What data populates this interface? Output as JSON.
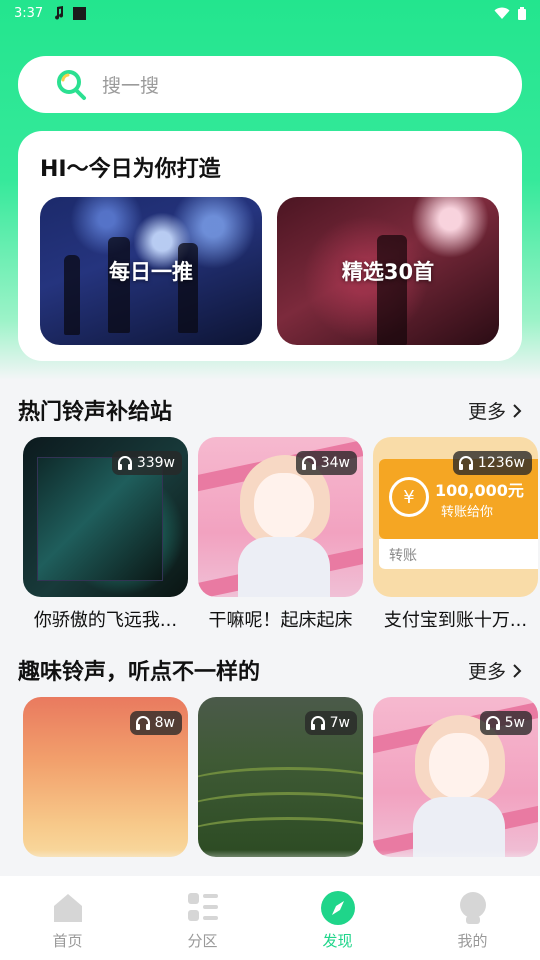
{
  "status": {
    "time": "3:37"
  },
  "search": {
    "placeholder": "搜一搜"
  },
  "today": {
    "title": "HI～今日为你打造",
    "promos": [
      {
        "label": "每日一推"
      },
      {
        "label": "精选30首"
      }
    ]
  },
  "section1": {
    "title": "热门铃声补给站",
    "more": "更多",
    "items": [
      {
        "caption": "你骄傲的飞远我...",
        "plays": "339w"
      },
      {
        "caption": "干嘛呢！起床起床",
        "plays": "34w"
      },
      {
        "caption": "支付宝到账十万...",
        "plays": "1236w",
        "art_amount": "100,000元",
        "art_sub": "转账给你",
        "art_button": "转账"
      }
    ]
  },
  "section2": {
    "title": "趣味铃声，听点不一样的",
    "more": "更多",
    "items": [
      {
        "caption": "",
        "plays": "8w"
      },
      {
        "caption": "",
        "plays": "7w"
      },
      {
        "caption": "",
        "plays": "5w"
      }
    ]
  },
  "tabs": [
    {
      "label": "首页",
      "active": false
    },
    {
      "label": "分区",
      "active": false
    },
    {
      "label": "发现",
      "active": true
    },
    {
      "label": "我的",
      "active": false
    }
  ],
  "colors": {
    "accent": "#1fd58a",
    "header_green": "#23e58e"
  }
}
